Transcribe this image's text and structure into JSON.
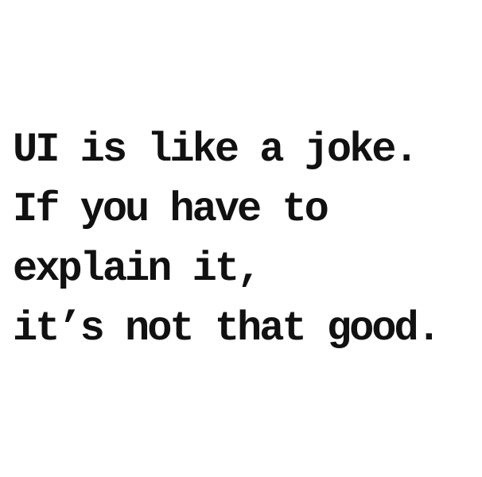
{
  "quote": {
    "lines": [
      "UI is like a joke.",
      "If you have to",
      "explain it,",
      "it’s not that good."
    ]
  },
  "colors": {
    "background": "#ffffff",
    "text": "#111111"
  }
}
